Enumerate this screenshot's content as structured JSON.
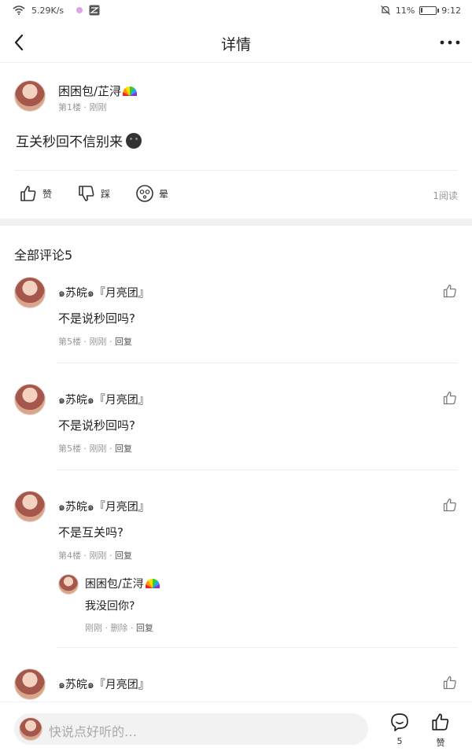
{
  "status_bar": {
    "network_speed": "5.29K/s",
    "battery_percent": "11%",
    "battery_level": 0.11,
    "time": "9:12",
    "icons": [
      "wifi-icon",
      "notification-app-icon",
      "mail-app-icon",
      "mute-bell-icon",
      "battery-icon"
    ]
  },
  "nav": {
    "title": "详情"
  },
  "post": {
    "author": "困困包/芷浔",
    "floor": "第1楼",
    "time": "刚刚",
    "content": "互关秒回不信别来",
    "actions": {
      "like": "赞",
      "dislike": "踩",
      "dizzy": "晕"
    },
    "read_count": "1阅读"
  },
  "comments_section": {
    "title": "全部评论5"
  },
  "comments": [
    {
      "author": "๑苏皖๑『月亮团』",
      "text": "不是说秒回吗?",
      "floor": "第5楼",
      "time": "刚刚",
      "reply_label": "回复"
    },
    {
      "author": "๑苏皖๑『月亮团』",
      "text": "不是说秒回吗?",
      "floor": "第5楼",
      "time": "刚刚",
      "reply_label": "回复"
    },
    {
      "author": "๑苏皖๑『月亮团』",
      "text": "不是互关吗?",
      "floor": "第4楼",
      "time": "刚刚",
      "reply_label": "回复",
      "sub_reply": {
        "author": "困困包/芷浔",
        "text": "我没回你?",
        "time": "刚刚",
        "delete_label": "删除",
        "reply_label": "回复"
      }
    },
    {
      "author": "๑苏皖๑『月亮团』"
    }
  ],
  "bottom_bar": {
    "input_placeholder": "快说点好听的…",
    "comment_count": "5",
    "like_label": "赞"
  }
}
